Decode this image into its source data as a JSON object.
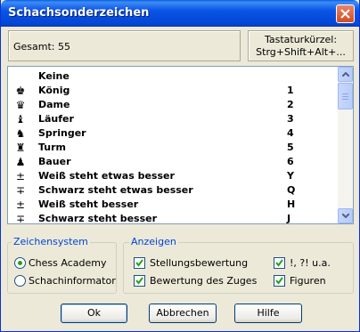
{
  "window": {
    "title": "Schachsonderzeichen"
  },
  "info": {
    "total": "Gesamt: 55",
    "hotkey_line1": "Tastaturkürzel:",
    "hotkey_line2": "Strg+Shift+Alt+..."
  },
  "list": {
    "rows": [
      {
        "symbol": "",
        "name": "Keine",
        "key": ""
      },
      {
        "symbol": "♚",
        "name": "König",
        "key": "1"
      },
      {
        "symbol": "♛",
        "name": "Dame",
        "key": "2"
      },
      {
        "symbol": "♝",
        "name": "Läufer",
        "key": "3"
      },
      {
        "symbol": "♞",
        "name": "Springer",
        "key": "4"
      },
      {
        "symbol": "♜",
        "name": "Turm",
        "key": "5"
      },
      {
        "symbol": "♟",
        "name": "Bauer",
        "key": "6"
      },
      {
        "symbol": "±",
        "name": "Weiß steht etwas besser",
        "key": "Y"
      },
      {
        "symbol": "∓",
        "name": "Schwarz steht etwas besser",
        "key": "Q"
      },
      {
        "symbol": "±",
        "name": "Weiß steht besser",
        "key": "H"
      },
      {
        "symbol": "∓",
        "name": "Schwarz steht besser",
        "key": "J"
      }
    ]
  },
  "zeichensystem": {
    "legend": "Zeichensystem",
    "options": [
      {
        "label": "Chess Academy",
        "selected": true
      },
      {
        "label": "Schachinformator",
        "selected": false
      }
    ]
  },
  "anzeigen": {
    "legend": "Anzeigen",
    "options": [
      {
        "label": "Stellungsbewertung",
        "checked": true
      },
      {
        "label": "!, ?! u.a.",
        "checked": true
      },
      {
        "label": "Bewertung des Zuges",
        "checked": true
      },
      {
        "label": "Figuren",
        "checked": true
      }
    ]
  },
  "buttons": {
    "ok": "Ok",
    "cancel": "Abbrechen",
    "help": "Hilfe"
  },
  "colors": {
    "titlebar": "#0a54e5",
    "group_legend": "#0046d5",
    "radio_dot": "#21a121",
    "check_mark": "#21a121"
  }
}
